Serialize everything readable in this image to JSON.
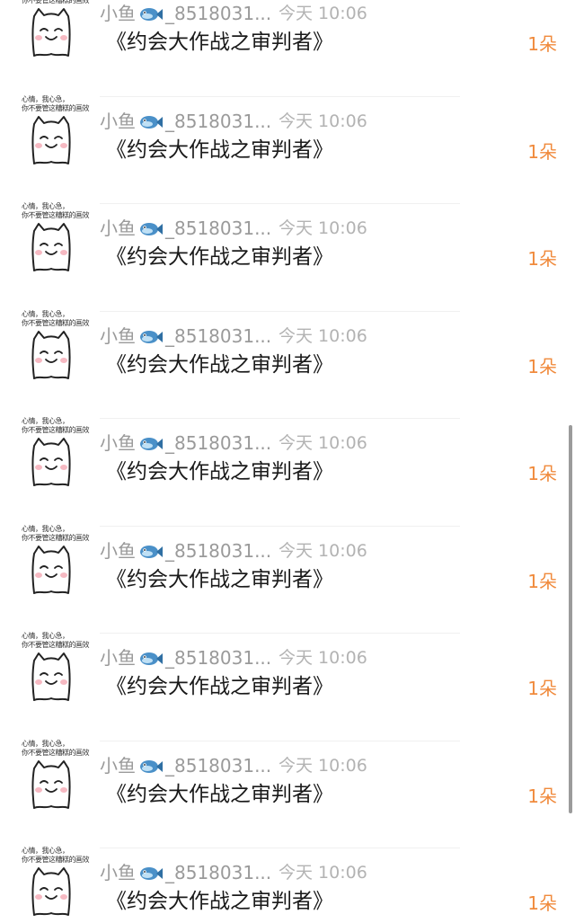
{
  "notifications": [
    {
      "avatar_caption": "心情，我心急，\n你不要管这糟糕的画效",
      "sender": "小鱼",
      "sender_suffix": "_8518031...",
      "time": "今天 10:06",
      "title": "《约会大作战之审判者》",
      "count": "1朵"
    },
    {
      "avatar_caption": "心情，我心急，\n你不要管这糟糕的画效",
      "sender": "小鱼",
      "sender_suffix": "_8518031...",
      "time": "今天 10:06",
      "title": "《约会大作战之审判者》",
      "count": "1朵"
    },
    {
      "avatar_caption": "心情，我心急，\n你不要管这糟糕的画效",
      "sender": "小鱼",
      "sender_suffix": "_8518031...",
      "time": "今天 10:06",
      "title": "《约会大作战之审判者》",
      "count": "1朵"
    },
    {
      "avatar_caption": "心情，我心急，\n你不要管这糟糕的画效",
      "sender": "小鱼",
      "sender_suffix": "_8518031...",
      "time": "今天 10:06",
      "title": "《约会大作战之审判者》",
      "count": "1朵"
    },
    {
      "avatar_caption": "心情，我心急，\n你不要管这糟糕的画效",
      "sender": "小鱼",
      "sender_suffix": "_8518031...",
      "time": "今天 10:06",
      "title": "《约会大作战之审判者》",
      "count": "1朵"
    },
    {
      "avatar_caption": "心情，我心急，\n你不要管这糟糕的画效",
      "sender": "小鱼",
      "sender_suffix": "_8518031...",
      "time": "今天 10:06",
      "title": "《约会大作战之审判者》",
      "count": "1朵"
    },
    {
      "avatar_caption": "心情，我心急，\n你不要管这糟糕的画效",
      "sender": "小鱼",
      "sender_suffix": "_8518031...",
      "time": "今天 10:06",
      "title": "《约会大作战之审判者》",
      "count": "1朵"
    },
    {
      "avatar_caption": "心情，我心急，\n你不要管这糟糕的画效",
      "sender": "小鱼",
      "sender_suffix": "_8518031...",
      "time": "今天 10:06",
      "title": "《约会大作战之审判者》",
      "count": "1朵"
    },
    {
      "avatar_caption": "心情，我心急，\n你不要管这糟糕的画效",
      "sender": "小鱼",
      "sender_suffix": "_8518031...",
      "time": "今天 10:06",
      "title": "《约会大作战之审判者》",
      "count": "1朵"
    }
  ],
  "icons": {
    "avatar": "cat-avatar-icon",
    "sender_emoji": "fish-icon"
  },
  "colors": {
    "count": "#f08a3c",
    "sender": "#9a9a9a",
    "time": "#b3b3b3",
    "title": "#1a1a1a",
    "fish_body": "#4a90c8"
  }
}
